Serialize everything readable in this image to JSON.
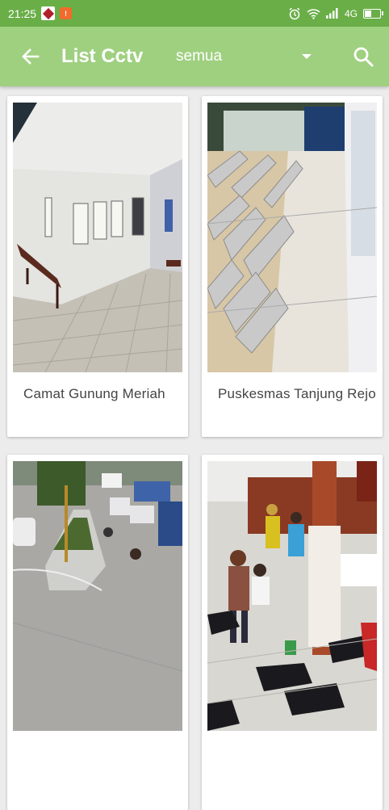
{
  "status_bar": {
    "time": "21:25",
    "network": "4G",
    "icons": [
      "notification-app-icon",
      "notification-alert-icon",
      "alarm-icon",
      "wifi-icon",
      "signal-icon",
      "battery-icon"
    ]
  },
  "app_bar": {
    "title": "List Cctv",
    "filter_value": "semua",
    "icons": [
      "back-arrow-icon",
      "dropdown-caret-icon",
      "search-icon"
    ]
  },
  "colors": {
    "status_bar": "#6aae48",
    "app_bar": "#9fd080",
    "background": "#ececec"
  },
  "cameras": [
    {
      "label": "Camat Gunung Meriah"
    },
    {
      "label": "Puskesmas Tanjung Rejo"
    },
    {
      "label": ""
    },
    {
      "label": ""
    }
  ]
}
